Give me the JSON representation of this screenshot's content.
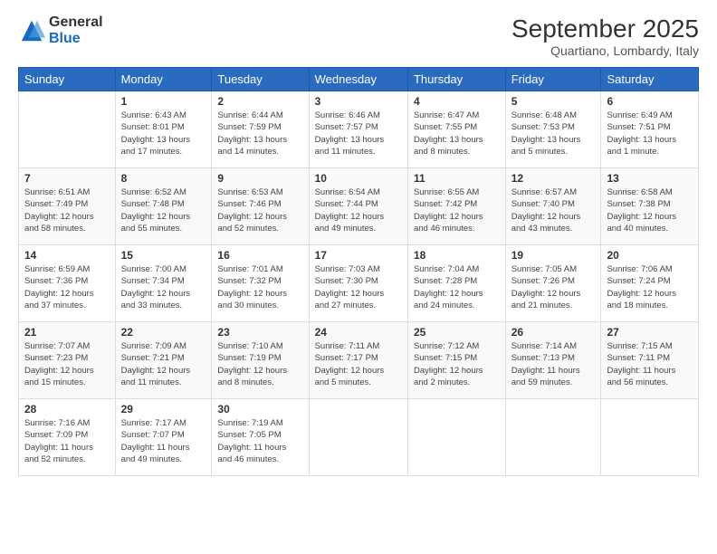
{
  "logo": {
    "general": "General",
    "blue": "Blue"
  },
  "header": {
    "month": "September 2025",
    "location": "Quartiano, Lombardy, Italy"
  },
  "weekdays": [
    "Sunday",
    "Monday",
    "Tuesday",
    "Wednesday",
    "Thursday",
    "Friday",
    "Saturday"
  ],
  "weeks": [
    [
      {
        "day": null,
        "info": ""
      },
      {
        "day": "1",
        "info": "Sunrise: 6:43 AM\nSunset: 8:01 PM\nDaylight: 13 hours\nand 17 minutes."
      },
      {
        "day": "2",
        "info": "Sunrise: 6:44 AM\nSunset: 7:59 PM\nDaylight: 13 hours\nand 14 minutes."
      },
      {
        "day": "3",
        "info": "Sunrise: 6:46 AM\nSunset: 7:57 PM\nDaylight: 13 hours\nand 11 minutes."
      },
      {
        "day": "4",
        "info": "Sunrise: 6:47 AM\nSunset: 7:55 PM\nDaylight: 13 hours\nand 8 minutes."
      },
      {
        "day": "5",
        "info": "Sunrise: 6:48 AM\nSunset: 7:53 PM\nDaylight: 13 hours\nand 5 minutes."
      },
      {
        "day": "6",
        "info": "Sunrise: 6:49 AM\nSunset: 7:51 PM\nDaylight: 13 hours\nand 1 minute."
      }
    ],
    [
      {
        "day": "7",
        "info": "Sunrise: 6:51 AM\nSunset: 7:49 PM\nDaylight: 12 hours\nand 58 minutes."
      },
      {
        "day": "8",
        "info": "Sunrise: 6:52 AM\nSunset: 7:48 PM\nDaylight: 12 hours\nand 55 minutes."
      },
      {
        "day": "9",
        "info": "Sunrise: 6:53 AM\nSunset: 7:46 PM\nDaylight: 12 hours\nand 52 minutes."
      },
      {
        "day": "10",
        "info": "Sunrise: 6:54 AM\nSunset: 7:44 PM\nDaylight: 12 hours\nand 49 minutes."
      },
      {
        "day": "11",
        "info": "Sunrise: 6:55 AM\nSunset: 7:42 PM\nDaylight: 12 hours\nand 46 minutes."
      },
      {
        "day": "12",
        "info": "Sunrise: 6:57 AM\nSunset: 7:40 PM\nDaylight: 12 hours\nand 43 minutes."
      },
      {
        "day": "13",
        "info": "Sunrise: 6:58 AM\nSunset: 7:38 PM\nDaylight: 12 hours\nand 40 minutes."
      }
    ],
    [
      {
        "day": "14",
        "info": "Sunrise: 6:59 AM\nSunset: 7:36 PM\nDaylight: 12 hours\nand 37 minutes."
      },
      {
        "day": "15",
        "info": "Sunrise: 7:00 AM\nSunset: 7:34 PM\nDaylight: 12 hours\nand 33 minutes."
      },
      {
        "day": "16",
        "info": "Sunrise: 7:01 AM\nSunset: 7:32 PM\nDaylight: 12 hours\nand 30 minutes."
      },
      {
        "day": "17",
        "info": "Sunrise: 7:03 AM\nSunset: 7:30 PM\nDaylight: 12 hours\nand 27 minutes."
      },
      {
        "day": "18",
        "info": "Sunrise: 7:04 AM\nSunset: 7:28 PM\nDaylight: 12 hours\nand 24 minutes."
      },
      {
        "day": "19",
        "info": "Sunrise: 7:05 AM\nSunset: 7:26 PM\nDaylight: 12 hours\nand 21 minutes."
      },
      {
        "day": "20",
        "info": "Sunrise: 7:06 AM\nSunset: 7:24 PM\nDaylight: 12 hours\nand 18 minutes."
      }
    ],
    [
      {
        "day": "21",
        "info": "Sunrise: 7:07 AM\nSunset: 7:23 PM\nDaylight: 12 hours\nand 15 minutes."
      },
      {
        "day": "22",
        "info": "Sunrise: 7:09 AM\nSunset: 7:21 PM\nDaylight: 12 hours\nand 11 minutes."
      },
      {
        "day": "23",
        "info": "Sunrise: 7:10 AM\nSunset: 7:19 PM\nDaylight: 12 hours\nand 8 minutes."
      },
      {
        "day": "24",
        "info": "Sunrise: 7:11 AM\nSunset: 7:17 PM\nDaylight: 12 hours\nand 5 minutes."
      },
      {
        "day": "25",
        "info": "Sunrise: 7:12 AM\nSunset: 7:15 PM\nDaylight: 12 hours\nand 2 minutes."
      },
      {
        "day": "26",
        "info": "Sunrise: 7:14 AM\nSunset: 7:13 PM\nDaylight: 11 hours\nand 59 minutes."
      },
      {
        "day": "27",
        "info": "Sunrise: 7:15 AM\nSunset: 7:11 PM\nDaylight: 11 hours\nand 56 minutes."
      }
    ],
    [
      {
        "day": "28",
        "info": "Sunrise: 7:16 AM\nSunset: 7:09 PM\nDaylight: 11 hours\nand 52 minutes."
      },
      {
        "day": "29",
        "info": "Sunrise: 7:17 AM\nSunset: 7:07 PM\nDaylight: 11 hours\nand 49 minutes."
      },
      {
        "day": "30",
        "info": "Sunrise: 7:19 AM\nSunset: 7:05 PM\nDaylight: 11 hours\nand 46 minutes."
      },
      {
        "day": null,
        "info": ""
      },
      {
        "day": null,
        "info": ""
      },
      {
        "day": null,
        "info": ""
      },
      {
        "day": null,
        "info": ""
      }
    ]
  ]
}
